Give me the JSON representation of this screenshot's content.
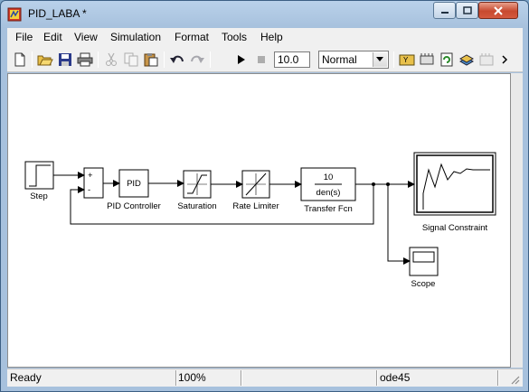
{
  "window": {
    "title": "PID_LABA *"
  },
  "menu": [
    "File",
    "Edit",
    "View",
    "Simulation",
    "Format",
    "Tools",
    "Help"
  ],
  "toolbar": {
    "icons": [
      "new-icon",
      "open-icon",
      "save-icon",
      "print-icon",
      "cut-icon",
      "copy-icon",
      "paste-icon",
      "undo-icon",
      "redo-icon",
      "play-icon",
      "stop-icon",
      "library-icon",
      "debug-icon",
      "refresh-icon",
      "model-explorer-icon",
      "build-icon"
    ],
    "stop_time": "10.0",
    "sim_mode": "Normal"
  },
  "blocks": {
    "step": "Step",
    "sum_plus": "+",
    "sum_minus": "-",
    "pid_text": "PID",
    "pid": "PID Controller",
    "saturation": "Saturation",
    "rate_limiter": "Rate Limiter",
    "tf_num": "10",
    "tf_den": "den(s)",
    "tf": "Transfer Fcn",
    "signal_constraint": "Signal Constraint",
    "scope": "Scope"
  },
  "status": {
    "state": "Ready",
    "zoom": "100%",
    "solver": "ode45"
  }
}
